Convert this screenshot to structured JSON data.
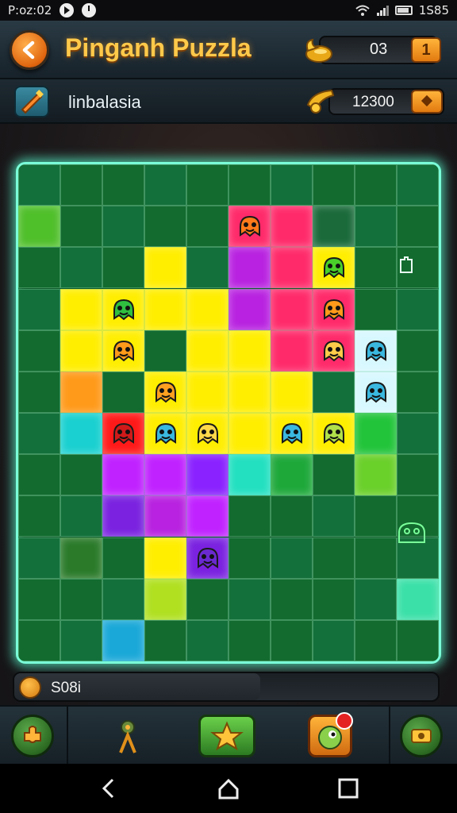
{
  "status_bar": {
    "time": "P:oz:02",
    "right_text": "1S85"
  },
  "header": {
    "title": "Pinganh Puzzla",
    "coins": "03",
    "coin_plus_label": "1"
  },
  "level": {
    "name": "linbalasia",
    "score": "12300"
  },
  "timer": {
    "value": "S08i"
  },
  "toolbar": {
    "items": [
      "hint-piece",
      "border-pieces",
      "star-rating",
      "monster-helper",
      "camera-preview"
    ]
  },
  "board": {
    "cols": 10,
    "rows": 12,
    "base_color": "#136b2f",
    "accent": "#7affd8",
    "pieces": [
      {
        "c": 0,
        "r": 1,
        "color": "#4fbf2a"
      },
      {
        "c": 5,
        "r": 1,
        "color": "#ff2a6a"
      },
      {
        "c": 6,
        "r": 1,
        "color": "#ff2a6a"
      },
      {
        "c": 7,
        "r": 1,
        "color": "#1a6a3a"
      },
      {
        "c": 3,
        "r": 2,
        "color": "#ffee00"
      },
      {
        "c": 5,
        "r": 2,
        "color": "#b822e0"
      },
      {
        "c": 6,
        "r": 2,
        "color": "#ff2a6a"
      },
      {
        "c": 7,
        "r": 2,
        "color": "#ffee00"
      },
      {
        "c": 1,
        "r": 3,
        "color": "#ffee00"
      },
      {
        "c": 2,
        "r": 3,
        "color": "#ffee00"
      },
      {
        "c": 3,
        "r": 3,
        "color": "#ffee00"
      },
      {
        "c": 4,
        "r": 3,
        "color": "#ffee00"
      },
      {
        "c": 5,
        "r": 3,
        "color": "#b822e0"
      },
      {
        "c": 6,
        "r": 3,
        "color": "#ff2a6a"
      },
      {
        "c": 7,
        "r": 3,
        "color": "#ff2a6a"
      },
      {
        "c": 1,
        "r": 4,
        "color": "#ffee00"
      },
      {
        "c": 2,
        "r": 4,
        "color": "#ffee00"
      },
      {
        "c": 4,
        "r": 4,
        "color": "#ffee00"
      },
      {
        "c": 5,
        "r": 4,
        "color": "#ffee00"
      },
      {
        "c": 6,
        "r": 4,
        "color": "#ff2a6a"
      },
      {
        "c": 7,
        "r": 4,
        "color": "#ff2a6a"
      },
      {
        "c": 8,
        "r": 4,
        "color": "#d8f8ff"
      },
      {
        "c": 1,
        "r": 5,
        "color": "#ff9a1a"
      },
      {
        "c": 3,
        "r": 5,
        "color": "#ffee00"
      },
      {
        "c": 4,
        "r": 5,
        "color": "#ffee00"
      },
      {
        "c": 5,
        "r": 5,
        "color": "#ffee00"
      },
      {
        "c": 6,
        "r": 5,
        "color": "#ffee00"
      },
      {
        "c": 8,
        "r": 5,
        "color": "#d8f8ff"
      },
      {
        "c": 1,
        "r": 6,
        "color": "#1ad0d0"
      },
      {
        "c": 2,
        "r": 6,
        "color": "#ff1a1a"
      },
      {
        "c": 3,
        "r": 6,
        "color": "#ffee00"
      },
      {
        "c": 4,
        "r": 6,
        "color": "#ffee00"
      },
      {
        "c": 5,
        "r": 6,
        "color": "#ffee00"
      },
      {
        "c": 6,
        "r": 6,
        "color": "#ffee00"
      },
      {
        "c": 7,
        "r": 6,
        "color": "#ffee00"
      },
      {
        "c": 8,
        "r": 6,
        "color": "#22c43a"
      },
      {
        "c": 2,
        "r": 7,
        "color": "#c022ff"
      },
      {
        "c": 3,
        "r": 7,
        "color": "#c022ff"
      },
      {
        "c": 4,
        "r": 7,
        "color": "#8a22ff"
      },
      {
        "c": 5,
        "r": 7,
        "color": "#22e0c0"
      },
      {
        "c": 6,
        "r": 7,
        "color": "#1ea83a"
      },
      {
        "c": 8,
        "r": 7,
        "color": "#6ad02a"
      },
      {
        "c": 2,
        "r": 8,
        "color": "#7a22e0"
      },
      {
        "c": 3,
        "r": 8,
        "color": "#b822e0"
      },
      {
        "c": 4,
        "r": 8,
        "color": "#c022ff"
      },
      {
        "c": 1,
        "r": 9,
        "color": "#2a7a2a"
      },
      {
        "c": 3,
        "r": 9,
        "color": "#ffee00"
      },
      {
        "c": 4,
        "r": 9,
        "color": "#7a22e0"
      },
      {
        "c": 3,
        "r": 10,
        "color": "#b0e020"
      },
      {
        "c": 9,
        "r": 10,
        "color": "#3ae0a8"
      },
      {
        "c": 2,
        "r": 11,
        "color": "#1aa8d8"
      }
    ],
    "monsters": [
      {
        "c": 5,
        "r": 1,
        "color": "#ff7a1a",
        "icon": "orange-monster"
      },
      {
        "c": 7,
        "r": 2,
        "color": "#4ad02a",
        "icon": "green-monster"
      },
      {
        "c": 2,
        "r": 3,
        "color": "#30c040",
        "icon": "lime-monster"
      },
      {
        "c": 7,
        "r": 3,
        "color": "#ff9a1a",
        "icon": "orange-face-monster"
      },
      {
        "c": 2,
        "r": 4,
        "color": "#ff9a1a",
        "icon": "orange-face-monster"
      },
      {
        "c": 7,
        "r": 4,
        "color": "#ffcc4a",
        "icon": "yellow-face-monster"
      },
      {
        "c": 8,
        "r": 4,
        "color": "#3ab8e0",
        "icon": "blue-monster"
      },
      {
        "c": 3,
        "r": 5,
        "color": "#ffa020",
        "icon": "orange-face-monster"
      },
      {
        "c": 8,
        "r": 5,
        "color": "#3ab8e0",
        "icon": "blue-monster"
      },
      {
        "c": 2,
        "r": 6,
        "color": "#d01a1a",
        "icon": "red-monster"
      },
      {
        "c": 3,
        "r": 6,
        "color": "#3ab8e0",
        "icon": "blue-monster"
      },
      {
        "c": 4,
        "r": 6,
        "color": "#ffd84a",
        "icon": "yellow-face-monster"
      },
      {
        "c": 6,
        "r": 6,
        "color": "#3ab8e0",
        "icon": "blue-monster"
      },
      {
        "c": 7,
        "r": 6,
        "color": "#b0e04a",
        "icon": "lime-monster"
      },
      {
        "c": 4,
        "r": 9,
        "color": "#6a2ad0",
        "icon": "purple-monster"
      }
    ]
  }
}
